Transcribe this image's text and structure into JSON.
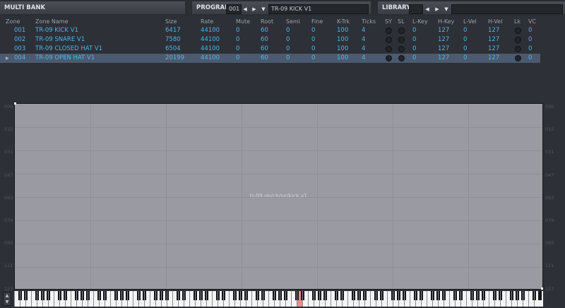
{
  "toolbar": {
    "multibank_title": "MULTI BANK",
    "program_title": "PROGRAM",
    "program_number": "001",
    "program_name": "TR-09 KICK V1",
    "library_title": "LIBRARY",
    "prev_icon": "arrow-left-icon",
    "next_icon": "arrow-right-icon",
    "menu_icon": "dropdown-icon"
  },
  "zone_table": {
    "columns": [
      "Zone",
      "Zone Name",
      "Size",
      "Rate",
      "Mute",
      "Root",
      "Semi",
      "Fine",
      "K-Trk",
      "Ticks",
      "SY",
      "SL",
      "L-Key",
      "H-Key",
      "L-Vel",
      "H-Vel",
      "Lk",
      "VC"
    ],
    "rows": [
      {
        "zone": "001",
        "name": "TR-09 KICK V1",
        "size": "6417",
        "rate": "44100",
        "mute": "0",
        "root": "60",
        "semi": "0",
        "fine": "0",
        "ktrk": "100",
        "ticks": "4",
        "lkey": "0",
        "hkey": "127",
        "lvel": "0",
        "hvel": "127",
        "vc": "0",
        "selected": false
      },
      {
        "zone": "002",
        "name": "TR-09 SNARE V1",
        "size": "7580",
        "rate": "44100",
        "mute": "0",
        "root": "60",
        "semi": "0",
        "fine": "0",
        "ktrk": "100",
        "ticks": "4",
        "lkey": "0",
        "hkey": "127",
        "lvel": "0",
        "hvel": "127",
        "vc": "0",
        "selected": false
      },
      {
        "zone": "003",
        "name": "TR-09 CLOSED HAT V1",
        "size": "6504",
        "rate": "44100",
        "mute": "0",
        "root": "60",
        "semi": "0",
        "fine": "0",
        "ktrk": "100",
        "ticks": "4",
        "lkey": "0",
        "hkey": "127",
        "lvel": "0",
        "hvel": "127",
        "vc": "0",
        "selected": false
      },
      {
        "zone": "004",
        "name": "TR-09 OPEN HAT V1",
        "size": "20199",
        "rate": "44100",
        "mute": "0",
        "root": "60",
        "semi": "0",
        "fine": "0",
        "ktrk": "100",
        "ticks": "4",
        "lkey": "0",
        "hkey": "127",
        "lvel": "0",
        "hvel": "127",
        "vc": "0",
        "selected": true
      }
    ]
  },
  "zone_map": {
    "label": "tr-09 oh/ch/sn/kick v1",
    "y_ticks": [
      "000",
      "015",
      "031",
      "047",
      "063",
      "079",
      "095",
      "111",
      "127"
    ],
    "highlighted_key_color": "#f08a8a"
  },
  "colors": {
    "accent": "#4fb5e8",
    "selected_row": "#4b5a6e"
  }
}
